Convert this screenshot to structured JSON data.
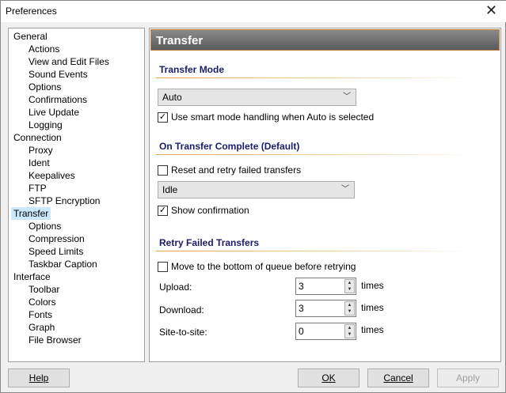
{
  "window": {
    "title": "Preferences",
    "close": "✕"
  },
  "tree": [
    {
      "label": "General",
      "level": 0
    },
    {
      "label": "Actions",
      "level": 1
    },
    {
      "label": "View and Edit Files",
      "level": 1
    },
    {
      "label": "Sound Events",
      "level": 1
    },
    {
      "label": "Options",
      "level": 1
    },
    {
      "label": "Confirmations",
      "level": 1
    },
    {
      "label": "Live Update",
      "level": 1
    },
    {
      "label": "Logging",
      "level": 1
    },
    {
      "label": "Connection",
      "level": 0
    },
    {
      "label": "Proxy",
      "level": 1
    },
    {
      "label": "Ident",
      "level": 1
    },
    {
      "label": "Keepalives",
      "level": 1
    },
    {
      "label": "FTP",
      "level": 1
    },
    {
      "label": "SFTP Encryption",
      "level": 1
    },
    {
      "label": "Transfer",
      "level": 0,
      "selected": true
    },
    {
      "label": "Options",
      "level": 1
    },
    {
      "label": "Compression",
      "level": 1
    },
    {
      "label": "Speed Limits",
      "level": 1
    },
    {
      "label": "Taskbar Caption",
      "level": 1
    },
    {
      "label": "Interface",
      "level": 0
    },
    {
      "label": "Toolbar",
      "level": 1
    },
    {
      "label": "Colors",
      "level": 1
    },
    {
      "label": "Fonts",
      "level": 1
    },
    {
      "label": "Graph",
      "level": 1
    },
    {
      "label": "File Browser",
      "level": 1
    }
  ],
  "panel": {
    "header": "Transfer",
    "transfer_mode": {
      "heading": "Transfer Mode",
      "mode": "Auto",
      "smart_mode_label": "Use smart mode handling when Auto is selected",
      "smart_mode_checked": true
    },
    "on_complete": {
      "heading": "On Transfer Complete (Default)",
      "reset_label": "Reset and retry failed transfers",
      "reset_checked": false,
      "action": "Idle",
      "show_confirmation_label": "Show confirmation",
      "show_confirmation_checked": true
    },
    "retry": {
      "heading": "Retry Failed Transfers",
      "move_label": "Move to the bottom of queue before retrying",
      "move_checked": false,
      "rows": [
        {
          "label": "Upload:",
          "value": "3",
          "unit": "times"
        },
        {
          "label": "Download:",
          "value": "3",
          "unit": "times"
        },
        {
          "label": "Site-to-site:",
          "value": "0",
          "unit": "times"
        }
      ]
    }
  },
  "buttons": {
    "help": "Help",
    "ok": "OK",
    "cancel": "Cancel",
    "apply": "Apply"
  }
}
